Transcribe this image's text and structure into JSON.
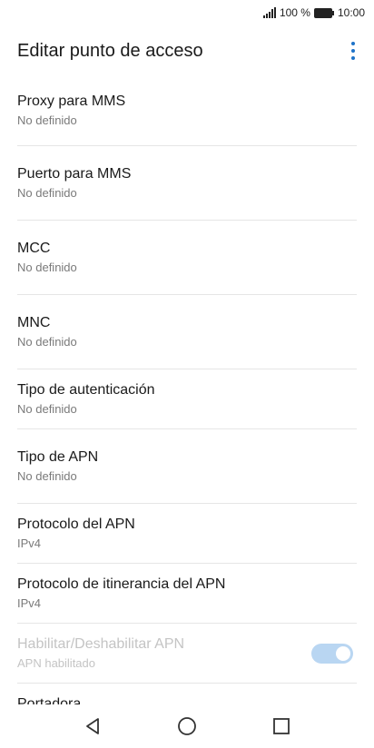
{
  "status_bar": {
    "battery_percent": "100 %",
    "time": "10:00"
  },
  "header": {
    "title": "Editar punto de acceso"
  },
  "items": [
    {
      "title": "Proxy para MMS",
      "value": "No definido"
    },
    {
      "title": "Puerto para MMS",
      "value": "No definido"
    },
    {
      "title": "MCC",
      "value": "No definido"
    },
    {
      "title": "MNC",
      "value": "No definido"
    },
    {
      "title": "Tipo de autenticación",
      "value": "No definido"
    },
    {
      "title": "Tipo de APN",
      "value": "No definido"
    },
    {
      "title": "Protocolo del APN",
      "value": "IPv4"
    },
    {
      "title": "Protocolo de itinerancia del APN",
      "value": "IPv4"
    },
    {
      "title": "Habilitar/Deshabilitar APN",
      "value": "APN habilitado",
      "toggle_on": true,
      "disabled": true
    },
    {
      "title": "Portadora"
    }
  ],
  "colors": {
    "accent": "#1e73c8",
    "toggle_track_disabled": "#b9d6f2"
  },
  "nav": {
    "back_icon": "back-triangle-icon",
    "home_icon": "home-circle-icon",
    "recents_icon": "recents-square-icon"
  }
}
